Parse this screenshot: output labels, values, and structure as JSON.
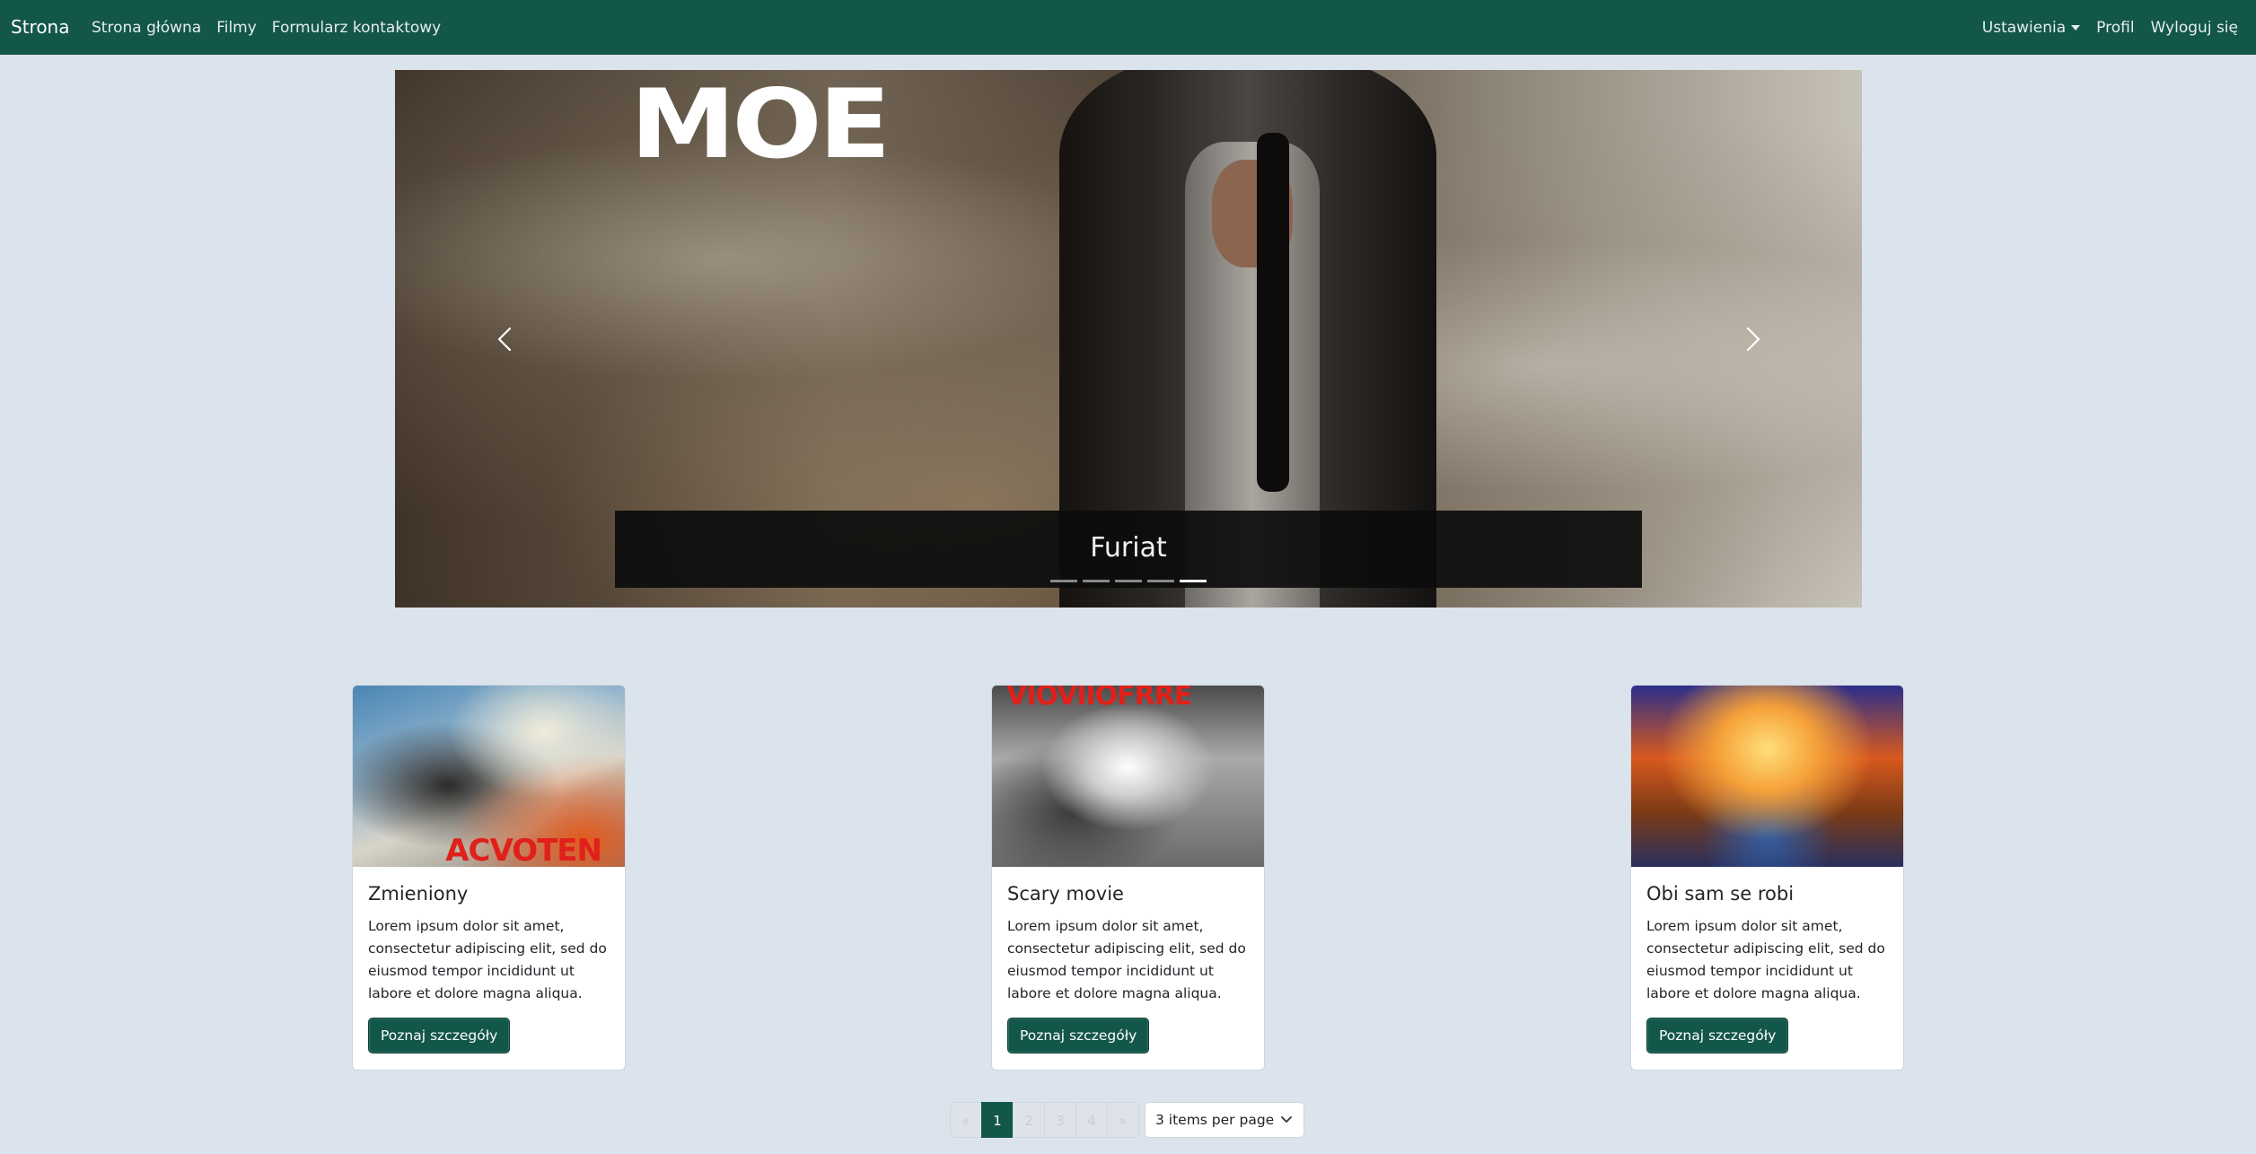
{
  "navbar": {
    "brand": "Strona",
    "links": [
      "Strona główna",
      "Filmy",
      "Formularz kontaktowy"
    ],
    "right": {
      "settings": "Ustawienia",
      "profile": "Profil",
      "logout": "Wyloguj się"
    }
  },
  "carousel": {
    "poster_text": "MOE",
    "caption": "Furiat",
    "indicators": 5,
    "active_index": 4
  },
  "cards": [
    {
      "title": "Zmieniony",
      "image_text": "ACVOTEN",
      "text": "Lorem ipsum dolor sit amet, consectetur adipiscing elit, sed do eiusmod tempor incididunt ut labore et dolore magna aliqua.",
      "button": "Poznaj szczegóły"
    },
    {
      "title": "Scary movie",
      "image_text": "VIOVIIOFRRE",
      "text": "Lorem ipsum dolor sit amet, consectetur adipiscing elit, sed do eiusmod tempor incididunt ut labore et dolore magna aliqua.",
      "button": "Poznaj szczegóły"
    },
    {
      "title": "Obi sam se robi",
      "image_text": "",
      "text": "Lorem ipsum dolor sit amet, consectetur adipiscing elit, sed do eiusmod tempor incididunt ut labore et dolore magna aliqua.",
      "button": "Poznaj szczegóły"
    }
  ],
  "pagination": {
    "prev": "«",
    "pages": [
      "1",
      "2",
      "3",
      "4"
    ],
    "next": "»",
    "current": "1",
    "per_page": "3 items per page"
  },
  "colors": {
    "navbar": "#13564a",
    "background": "#dbe4ec",
    "button": "#13564a"
  }
}
